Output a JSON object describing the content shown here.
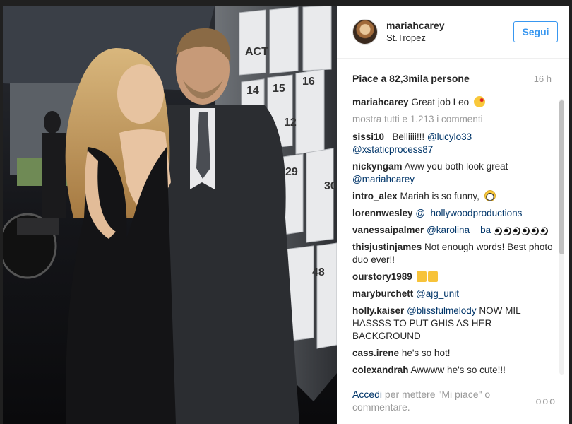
{
  "header": {
    "username": "mariahcarey",
    "location": "St.Tropez",
    "follow_label": "Segui"
  },
  "stats": {
    "likes": "Piace a 82,3mila persone",
    "time": "16 h"
  },
  "caption": {
    "user": "mariahcarey",
    "text": "Great job Leo",
    "emoji": "kiss-emoji"
  },
  "load_more": "mostra tutti e 1.213 i commenti",
  "comments": [
    {
      "user": "sissi10_",
      "text": "Belliiii!!!",
      "mentions": [
        "@lucylo33",
        "@xstaticprocess87"
      ]
    },
    {
      "user": "nickyngam",
      "text": "Aww you both look great",
      "mentions": [
        "@mariahcarey"
      ]
    },
    {
      "user": "intro_alex",
      "text": "Mariah is so funny,",
      "emoji": "grin-emoji"
    },
    {
      "user": "lorennwesley",
      "text": "",
      "mentions": [
        "@_hollywoodproductions_"
      ]
    },
    {
      "user": "vanessaipalmer",
      "text": "",
      "mentions": [
        "@karolina__ba"
      ],
      "emoji": "eyes-emoji"
    },
    {
      "user": "thisjustinjames",
      "text": "Not enough words! Best photo duo ever!!"
    },
    {
      "user": "ourstory1989",
      "text": "",
      "emoji": "thumbs-up-emoji"
    },
    {
      "user": "maryburchett",
      "text": "",
      "mentions": [
        "@ajg_unit"
      ]
    },
    {
      "user": "holly.kaiser",
      "text": "NOW MIL HASSSS TO PUT GHIS AS HER BACKGROUND",
      "mentions": [
        "@blissfulmelody"
      ]
    },
    {
      "user": "cass.irene",
      "text": "he's so hot!"
    },
    {
      "user": "colexandrah",
      "text": "Awwww he's so cute!!!"
    }
  ],
  "footer": {
    "login_label": "Accedi",
    "rest_text": "per mettere \"Mi piace\" o commentare.",
    "more_label": "ooo"
  },
  "photo": {
    "board_numbers": [
      "ACT",
      "15",
      "16",
      "14",
      "12",
      "29",
      "30",
      "48"
    ]
  },
  "colors": {
    "accent": "#3897f0",
    "link": "#003569",
    "muted": "#999999"
  }
}
